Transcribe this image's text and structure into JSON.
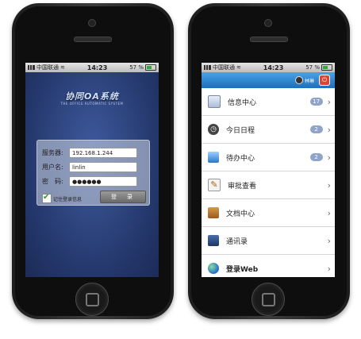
{
  "status_bar": {
    "carrier": "中国联通",
    "time": "14:23",
    "battery": "57 %"
  },
  "login_screen": {
    "logo_title": "协同OA系统",
    "logo_subtitle": "THE OFFICE AUTOMATIC SYSTEM",
    "server_label": "服务器:",
    "server_value": "192.168.1.244",
    "username_label": "用户名:",
    "username_value": "linlin",
    "password_label": "密　码:",
    "password_value": "●●●●●●",
    "remember_label": "记住登录信息",
    "remember_checked": true,
    "login_button": "登　录"
  },
  "menu_screen": {
    "header_user": "林琳",
    "items": [
      {
        "label": "信息中心",
        "badge": "17",
        "icon": "mail-icon"
      },
      {
        "label": "今日日程",
        "badge": "2",
        "icon": "clock-icon"
      },
      {
        "label": "待办中心",
        "badge": "2",
        "icon": "computer-icon"
      },
      {
        "label": "审批查看",
        "badge": "",
        "icon": "notepad-icon"
      },
      {
        "label": "文档中心",
        "badge": "",
        "icon": "briefcase-icon"
      },
      {
        "label": "通讯录",
        "badge": "",
        "icon": "address-book-icon"
      },
      {
        "label": "登录Web",
        "badge": "",
        "icon": "globe-icon"
      }
    ]
  },
  "colors": {
    "login_bg": "#2c4380",
    "header_blue": "#2a84d2",
    "badge": "#8fa4c8"
  }
}
